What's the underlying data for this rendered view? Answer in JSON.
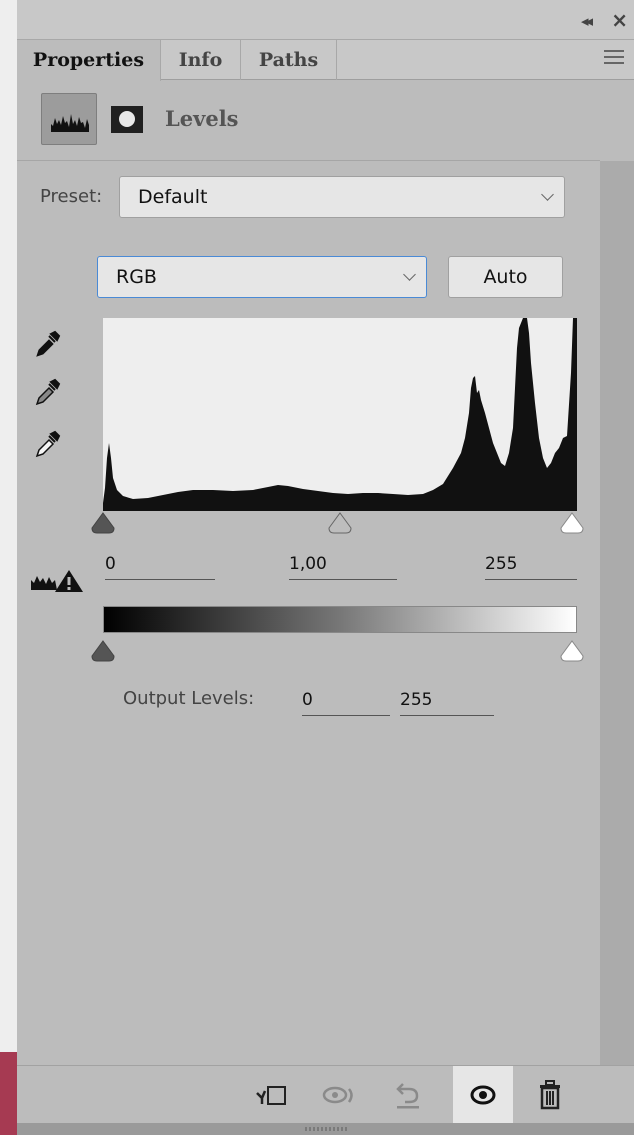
{
  "panel": {
    "tabs": [
      {
        "label": "Properties",
        "active": true
      },
      {
        "label": "Info",
        "active": false
      },
      {
        "label": "Paths",
        "active": false
      }
    ],
    "adjustment_title": "Levels"
  },
  "preset": {
    "label": "Preset:",
    "value": "Default"
  },
  "channel": {
    "value": "RGB",
    "auto_label": "Auto"
  },
  "input_levels": {
    "black": "0",
    "gamma": "1,00",
    "white": "255"
  },
  "output_levels": {
    "label": "Output Levels:",
    "black": "0",
    "white": "255"
  },
  "colors": {
    "panel_bg": "#bcbcbc",
    "histogram_bg": "#eeeeee",
    "histogram_fill": "#111111",
    "accent_focus": "#4a8ad6"
  },
  "icons": [
    "collapse-icon",
    "close-icon",
    "panel-menu-icon",
    "levels-histogram-icon",
    "layer-mask-icon",
    "black-eyedropper-icon",
    "gray-eyedropper-icon",
    "white-eyedropper-icon",
    "clipping-warning-icon",
    "clip-to-layer-icon",
    "view-previous-icon",
    "reset-icon",
    "visibility-eye-icon",
    "trash-icon"
  ]
}
